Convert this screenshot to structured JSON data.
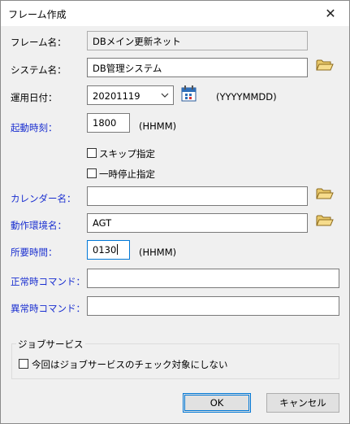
{
  "window": {
    "title": "フレーム作成"
  },
  "labels": {
    "frame_name": "フレーム名：",
    "system_name": "システム名：",
    "apply_date": "運用日付：",
    "start_time": "起動時刻：",
    "calendar_name": "カレンダー名：",
    "environment_name": "動作環境名：",
    "duration": "所要時間：",
    "normal_command": "正常時コマンド：",
    "error_command": "異常時コマンド："
  },
  "fields": {
    "frame_name": "DBメイン更新ネット",
    "system_name": "DB管理システム",
    "apply_date": "20201119",
    "start_time": "1800",
    "calendar_name": "",
    "environment_name": "AGT",
    "duration": "0130",
    "normal_command": "",
    "error_command": ""
  },
  "hints": {
    "date_format": "(YYYYMMDD)",
    "time_format": "(HHMM)",
    "duration_format": "(HHMM)"
  },
  "checkboxes": {
    "skip": {
      "label": "スキップ指定",
      "checked": false
    },
    "pause": {
      "label": "一時停止指定",
      "checked": false
    },
    "job_service": {
      "label": "今回はジョブサービスのチェック対象にしない",
      "checked": false
    }
  },
  "group": {
    "title": "ジョブサービス"
  },
  "buttons": {
    "ok": "OK",
    "cancel": "キャンセル"
  },
  "icons": {
    "folder": "folder-icon",
    "calendar": "calendar-icon",
    "close": "close-icon",
    "dropdown": "chevron-down-icon"
  },
  "colors": {
    "required_label": "#1a2fd0",
    "focus_border": "#0078d7"
  }
}
